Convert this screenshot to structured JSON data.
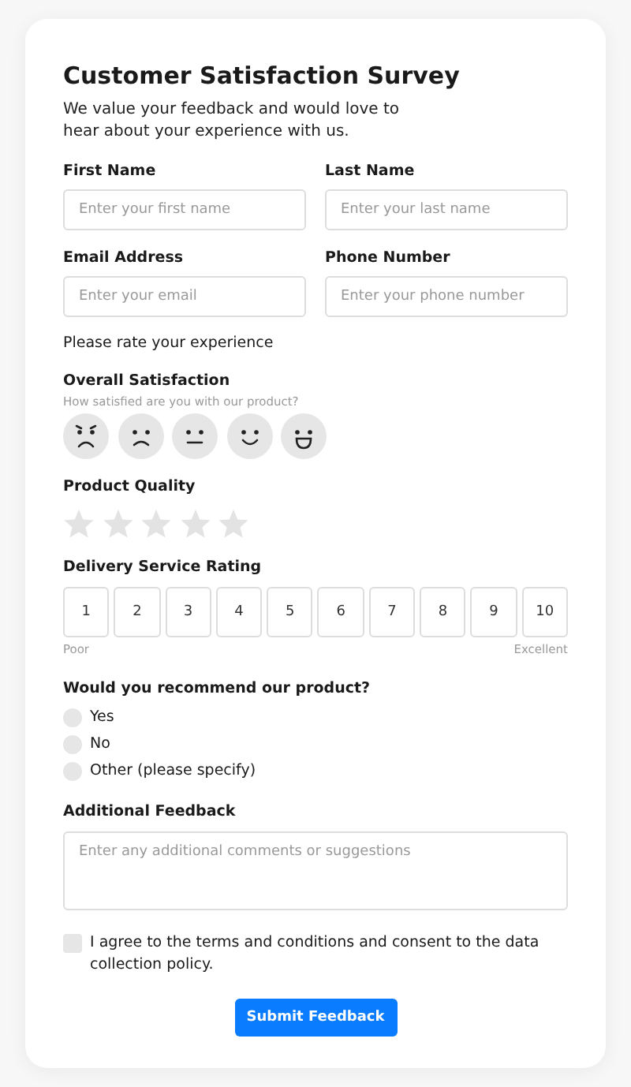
{
  "title": "Customer Satisfaction Survey",
  "subtitle": "We value your feedback and would love to hear about your experience with us.",
  "fields": [
    {
      "label": "First Name",
      "placeholder": "Enter your first name"
    },
    {
      "label": "Last Name",
      "placeholder": "Enter your last name"
    },
    {
      "label": "Email Address",
      "placeholder": "Enter your email"
    },
    {
      "label": "Phone Number",
      "placeholder": "Enter your phone number"
    }
  ],
  "rate_prompt": "Please rate your experience",
  "satisfaction": {
    "label": "Overall Satisfaction",
    "hint": "How satisfied are you with our product?",
    "faces": [
      {
        "kind": "angry",
        "selected": false
      },
      {
        "kind": "sad",
        "selected": false
      },
      {
        "kind": "neutral",
        "selected": false
      },
      {
        "kind": "smile",
        "selected": false
      },
      {
        "kind": "laugh",
        "selected": false
      }
    ]
  },
  "quality": {
    "label": "Product Quality",
    "stars": 0
  },
  "delivery": {
    "label": "Delivery Service Rating",
    "options": [
      {
        "label": "1",
        "selected": false
      },
      {
        "label": "2",
        "selected": false
      },
      {
        "label": "3",
        "selected": false
      },
      {
        "label": "4",
        "selected": false
      },
      {
        "label": "5",
        "selected": false
      },
      {
        "label": "6",
        "selected": false
      },
      {
        "label": "7",
        "selected": false
      },
      {
        "label": "8",
        "selected": false
      },
      {
        "label": "9",
        "selected": false
      },
      {
        "label": "10",
        "selected": false
      }
    ],
    "low_label": "Poor",
    "high_label": "Excellent"
  },
  "recommend": {
    "label": "Would you recommend our product?",
    "options": [
      {
        "label": "Yes",
        "selected": false
      },
      {
        "label": "No",
        "selected": false
      },
      {
        "label": "Other (please specify)",
        "selected": false
      }
    ]
  },
  "feedback": {
    "label": "Additional Feedback",
    "placeholder": "Enter any additional comments or suggestions"
  },
  "consent": {
    "label": "I agree to the terms and conditions and consent to the data collection policy.",
    "checked": false
  },
  "submit": "Submit Feedback"
}
